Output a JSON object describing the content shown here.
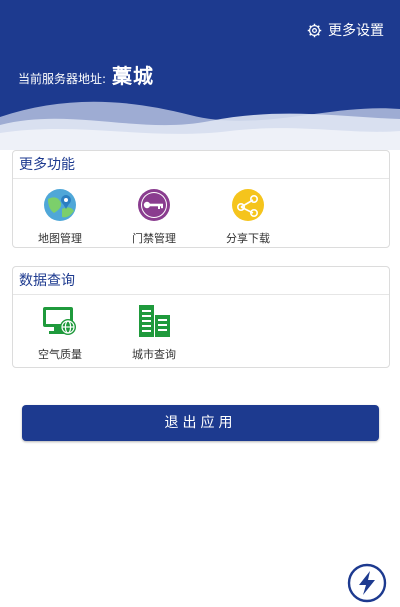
{
  "header": {
    "settings_label": "更多设置",
    "server_label": "当前服务器地址:",
    "server_value": "藁城"
  },
  "more_functions": {
    "title": "更多功能",
    "items": [
      {
        "label": "地图管理",
        "icon": "map-icon"
      },
      {
        "label": "门禁管理",
        "icon": "key-icon"
      },
      {
        "label": "分享下载",
        "icon": "share-icon"
      }
    ]
  },
  "data_query": {
    "title": "数据查询",
    "items": [
      {
        "label": "空气质量",
        "icon": "monitor-globe-icon"
      },
      {
        "label": "城市查询",
        "icon": "buildings-icon"
      }
    ]
  },
  "exit_label": "退出应用",
  "colors": {
    "primary": "#1d3a8f",
    "map_bg": "#4fa7d8",
    "key_bg": "#8a3c8f",
    "share_bg": "#f5c41c",
    "green": "#1f9a3c"
  }
}
